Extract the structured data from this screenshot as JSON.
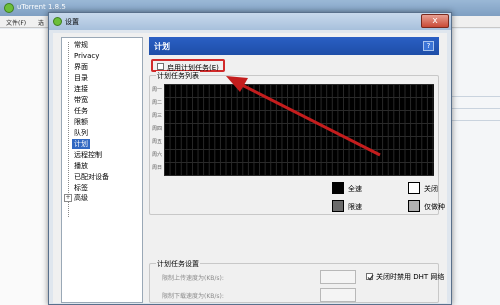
{
  "background_window": {
    "title": "uTorrent 1.8.5",
    "menu": [
      "文件(F)",
      "选"
    ]
  },
  "dialog": {
    "title": "设置",
    "close_glyph": "x"
  },
  "tree": {
    "items": [
      "常规",
      "Privacy",
      "界面",
      "目录",
      "连接",
      "带宽",
      "任务",
      "限额",
      "队列",
      "计划",
      "远程控制",
      "播放",
      "已配对设备",
      "标签",
      "高级"
    ],
    "selected": "计划",
    "expander": "+"
  },
  "panel": {
    "title": "计划",
    "help": "?",
    "enable_label": "启用计划任务(E)",
    "enable_checked": false,
    "grid_title": "计划任务列表",
    "days": [
      "周一",
      "周二",
      "周三",
      "周四",
      "周五",
      "周六",
      "周日"
    ],
    "legend": [
      {
        "label": "全速",
        "color": "#000000"
      },
      {
        "label": "关闭",
        "color": "#ffffff"
      },
      {
        "label": "限速",
        "color": "#6a6a6a"
      },
      {
        "label": "仅做种",
        "color": "#b0b0b0"
      }
    ],
    "settings_title": "计划任务设置",
    "upload_limit_label": "限制上传速度为(KB/s):",
    "upload_limit_value": "",
    "download_limit_label": "限制下载速度为(KB/s):",
    "download_limit_value": "",
    "dht_label": "关闭时禁用 DHT 网络",
    "dht_checked": true
  },
  "colors": {
    "header": "#2458b8",
    "selection": "#3168c2",
    "highlight": "#d12a2a"
  }
}
